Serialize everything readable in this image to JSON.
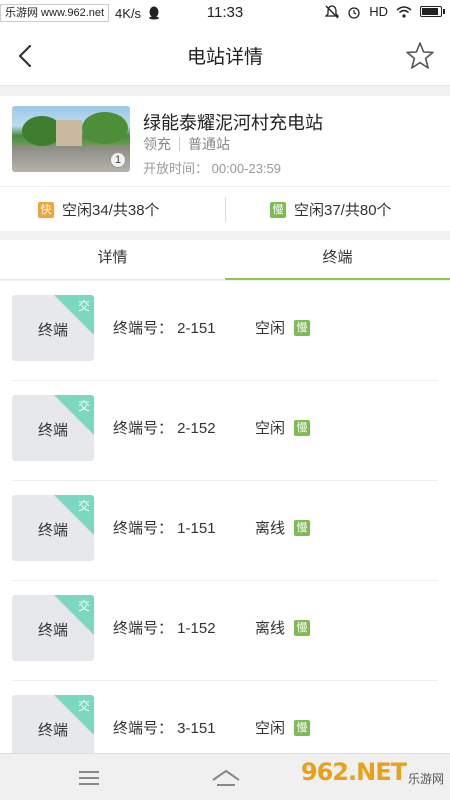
{
  "status_bar": {
    "site": "乐游网 www.962.net",
    "speed": "4K/s",
    "time": "11:33",
    "network": "HD"
  },
  "header": {
    "title": "电站详情"
  },
  "station": {
    "name": "绿能泰耀泥河村充电站",
    "operator": "领充",
    "type": "普通站",
    "hours": "开放时间：  00:00-23:59",
    "image_count": "1"
  },
  "availability": {
    "fast_tag": "快",
    "fast_text": "空闲34/共38个",
    "slow_tag": "慢",
    "slow_text": "空闲37/共80个"
  },
  "tabs": [
    {
      "label": "详情"
    },
    {
      "label": "终端"
    }
  ],
  "terminals": [
    {
      "box_label": "终端",
      "ac": "交",
      "no": "终端号：  2-151",
      "status": "空闲",
      "tag": "慢"
    },
    {
      "box_label": "终端",
      "ac": "交",
      "no": "终端号：  2-152",
      "status": "空闲",
      "tag": "慢"
    },
    {
      "box_label": "终端",
      "ac": "交",
      "no": "终端号：  1-151",
      "status": "离线",
      "tag": "慢"
    },
    {
      "box_label": "终端",
      "ac": "交",
      "no": "终端号：  1-152",
      "status": "离线",
      "tag": "慢"
    },
    {
      "box_label": "终端",
      "ac": "交",
      "no": "终端号：  3-151",
      "status": "空闲",
      "tag": "慢"
    }
  ],
  "watermark": {
    "logo": "962.NET",
    "sub": "乐游网"
  },
  "colors": {
    "fast": "#f0a43c",
    "slow": "#7dbb55",
    "ac_corner": "#7bd7bf",
    "tab_active_underline": "#8ac94e"
  },
  "icons": [
    "back-icon",
    "star-icon",
    "menu-icon",
    "home-icon",
    "alarm-icon",
    "wifi-icon",
    "battery-icon",
    "mute-icon"
  ]
}
